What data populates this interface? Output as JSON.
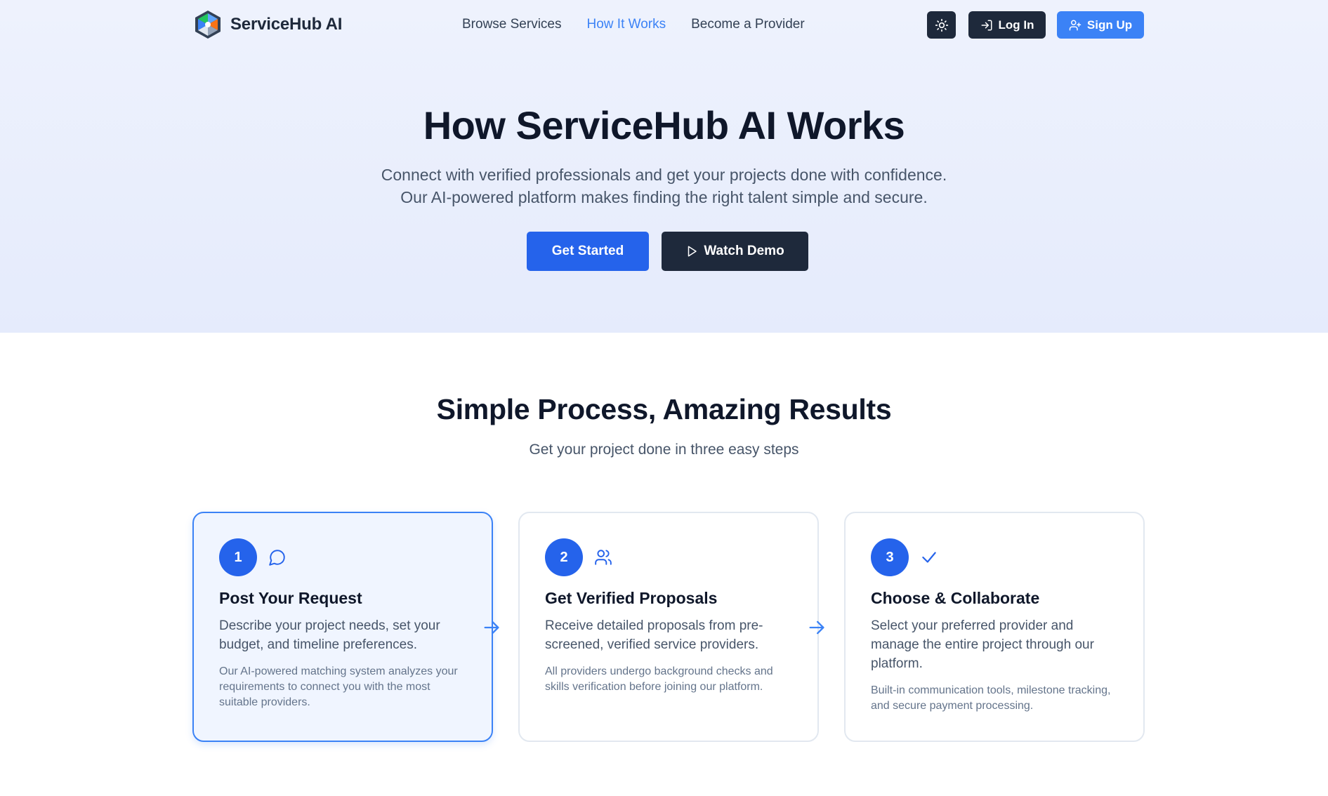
{
  "brand": {
    "name": "ServiceHub AI"
  },
  "nav": {
    "links": [
      {
        "label": "Browse Services",
        "active": false
      },
      {
        "label": "How It Works",
        "active": true
      },
      {
        "label": "Become a Provider",
        "active": false
      }
    ],
    "theme_icon": "sun-icon",
    "login_label": "Log In",
    "signup_label": "Sign Up"
  },
  "hero": {
    "title": "How ServiceHub AI Works",
    "subtitle_line1": "Connect with verified professionals and get your projects done with confidence.",
    "subtitle_line2": "Our AI-powered platform makes finding the right talent simple and secure.",
    "primary_cta": "Get Started",
    "secondary_cta": "Watch Demo"
  },
  "process": {
    "title": "Simple Process, Amazing Results",
    "subtitle": "Get your project done in three easy steps",
    "steps": [
      {
        "number": "1",
        "icon": "message-circle-icon",
        "title": "Post Your Request",
        "description": "Describe your project needs, set your budget, and timeline preferences.",
        "note": "Our AI-powered matching system analyzes your requirements to connect you with the most suitable providers."
      },
      {
        "number": "2",
        "icon": "users-icon",
        "title": "Get Verified Proposals",
        "description": "Receive detailed proposals from pre-screened, verified service providers.",
        "note": "All providers undergo background checks and skills verification before joining our platform."
      },
      {
        "number": "3",
        "icon": "check-icon",
        "title": "Choose & Collaborate",
        "description": "Select your preferred provider and manage the entire project through our platform.",
        "note": "Built-in communication tools, milestone tracking, and secure payment processing."
      }
    ]
  },
  "colors": {
    "accent": "#3b82f6",
    "primary": "#2563eb",
    "dark": "#1e293b",
    "hero_bg": "#eef2fd"
  }
}
